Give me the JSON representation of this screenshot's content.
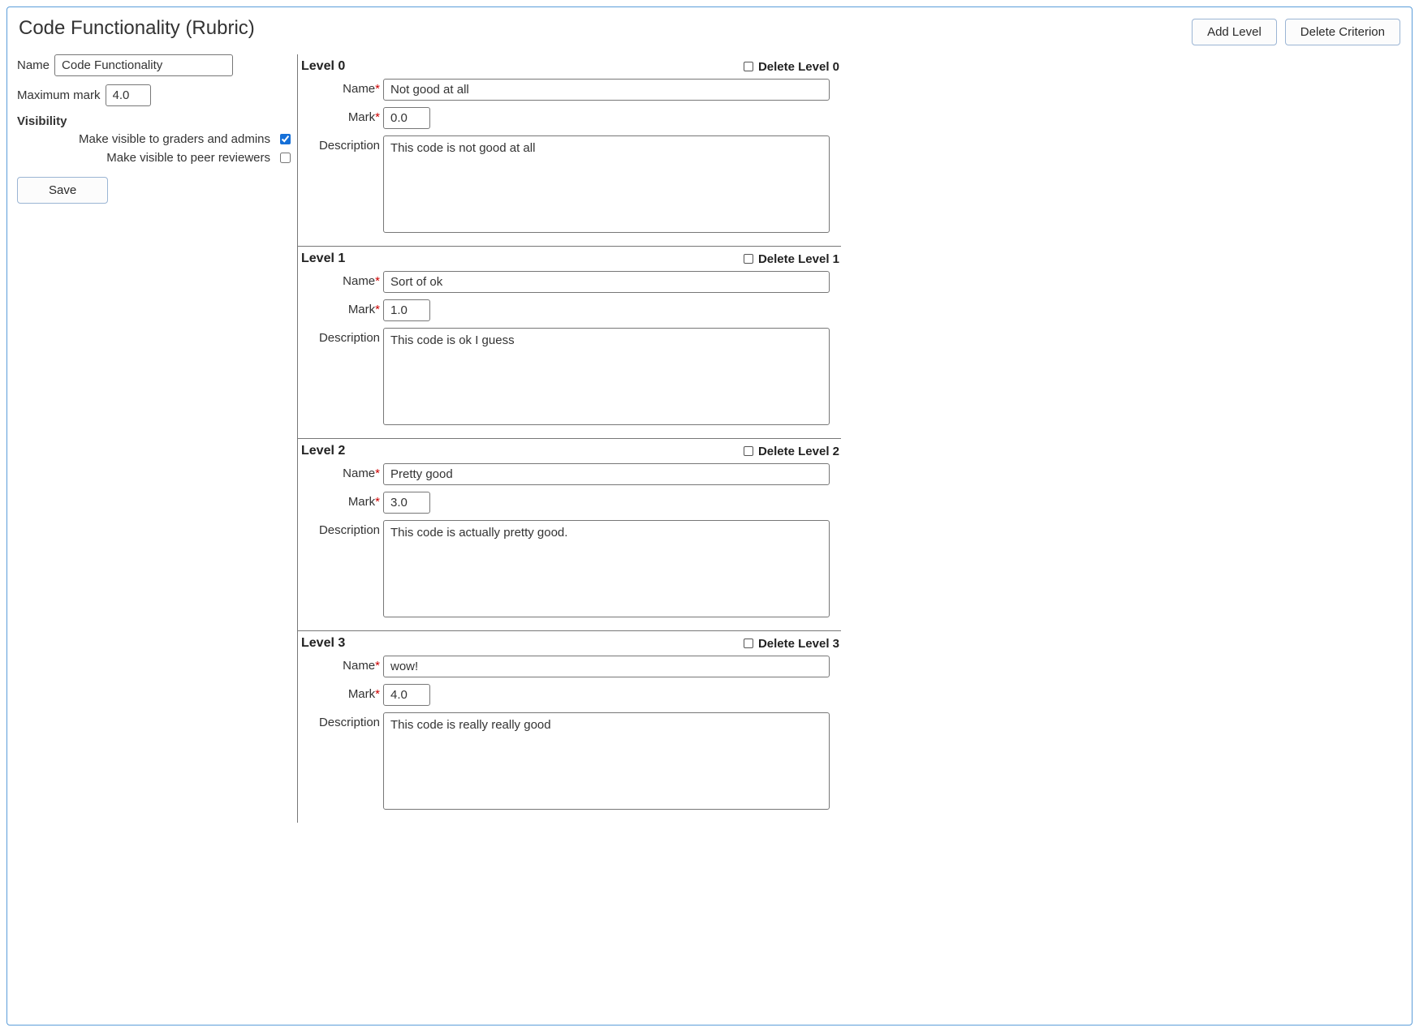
{
  "title": "Code Functionality (Rubric)",
  "actions": {
    "add_level": "Add Level",
    "delete_criterion": "Delete Criterion"
  },
  "sidebar": {
    "name_label": "Name",
    "name_value": "Code Functionality",
    "max_mark_label": "Maximum mark",
    "max_mark_value": "4.0",
    "visibility_label": "Visibility",
    "vis_graders_label": "Make visible to graders and admins",
    "vis_graders_checked": true,
    "vis_peer_label": "Make visible to peer reviewers",
    "vis_peer_checked": false,
    "save_label": "Save"
  },
  "field_labels": {
    "name": "Name",
    "mark": "Mark",
    "description": "Description",
    "required": "*"
  },
  "levels": [
    {
      "heading": "Level 0",
      "delete_label": "Delete Level 0",
      "name": "Not good at all",
      "mark": "0.0",
      "description": "This code is not good at all"
    },
    {
      "heading": "Level 1",
      "delete_label": "Delete Level 1",
      "name": "Sort of ok",
      "mark": "1.0",
      "description": "This code is ok I guess"
    },
    {
      "heading": "Level 2",
      "delete_label": "Delete Level 2",
      "name": "Pretty good",
      "mark": "3.0",
      "description": "This code is actually pretty good."
    },
    {
      "heading": "Level 3",
      "delete_label": "Delete Level 3",
      "name": "wow!",
      "mark": "4.0",
      "description": "This code is really really good"
    }
  ]
}
